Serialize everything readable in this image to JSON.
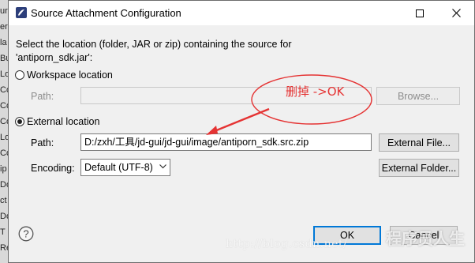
{
  "background": {
    "strip_letters": [
      "ur",
      "er",
      "la",
      "Bu",
      "Lo",
      "Co",
      "Co",
      "Co",
      "Lo",
      "Co",
      "ip",
      "Do",
      "ct",
      "Do",
      "T",
      "Re"
    ]
  },
  "window": {
    "title": "Source Attachment Configuration",
    "app_icon": "eclipse-icon",
    "maximize_icon": "maximize-icon",
    "close_icon": "close-icon"
  },
  "description": {
    "line1": "Select the location (folder, JAR or zip) containing the source for",
    "line2": "'antiporn_sdk.jar':"
  },
  "workspace": {
    "radio_label": "Workspace location",
    "selected": false,
    "path_label": "Path:",
    "path_value": "",
    "browse_label": "Browse..."
  },
  "external": {
    "radio_label": "External location",
    "selected": true,
    "path_label": "Path:",
    "path_value": "D:/zxh/工具/jd-gui/jd-gui/image/antiporn_sdk.src.zip",
    "external_file_label": "External File...",
    "encoding_label": "Encoding:",
    "encoding_value": "Default (UTF-8)",
    "external_folder_label": "External Folder..."
  },
  "footer": {
    "help_icon": "help-icon",
    "ok_label": "OK",
    "cancel_label": "Cancel"
  },
  "annotation": {
    "text": "删掉 ->OK",
    "color": "#e53333"
  },
  "watermark": {
    "url_text": "http://blog.csdn.net/",
    "brand_text": "程序员人生"
  },
  "colors": {
    "dialog_bg": "#f0f0f0",
    "primary_border": "#0078d7",
    "annotation_red": "#e53333"
  }
}
